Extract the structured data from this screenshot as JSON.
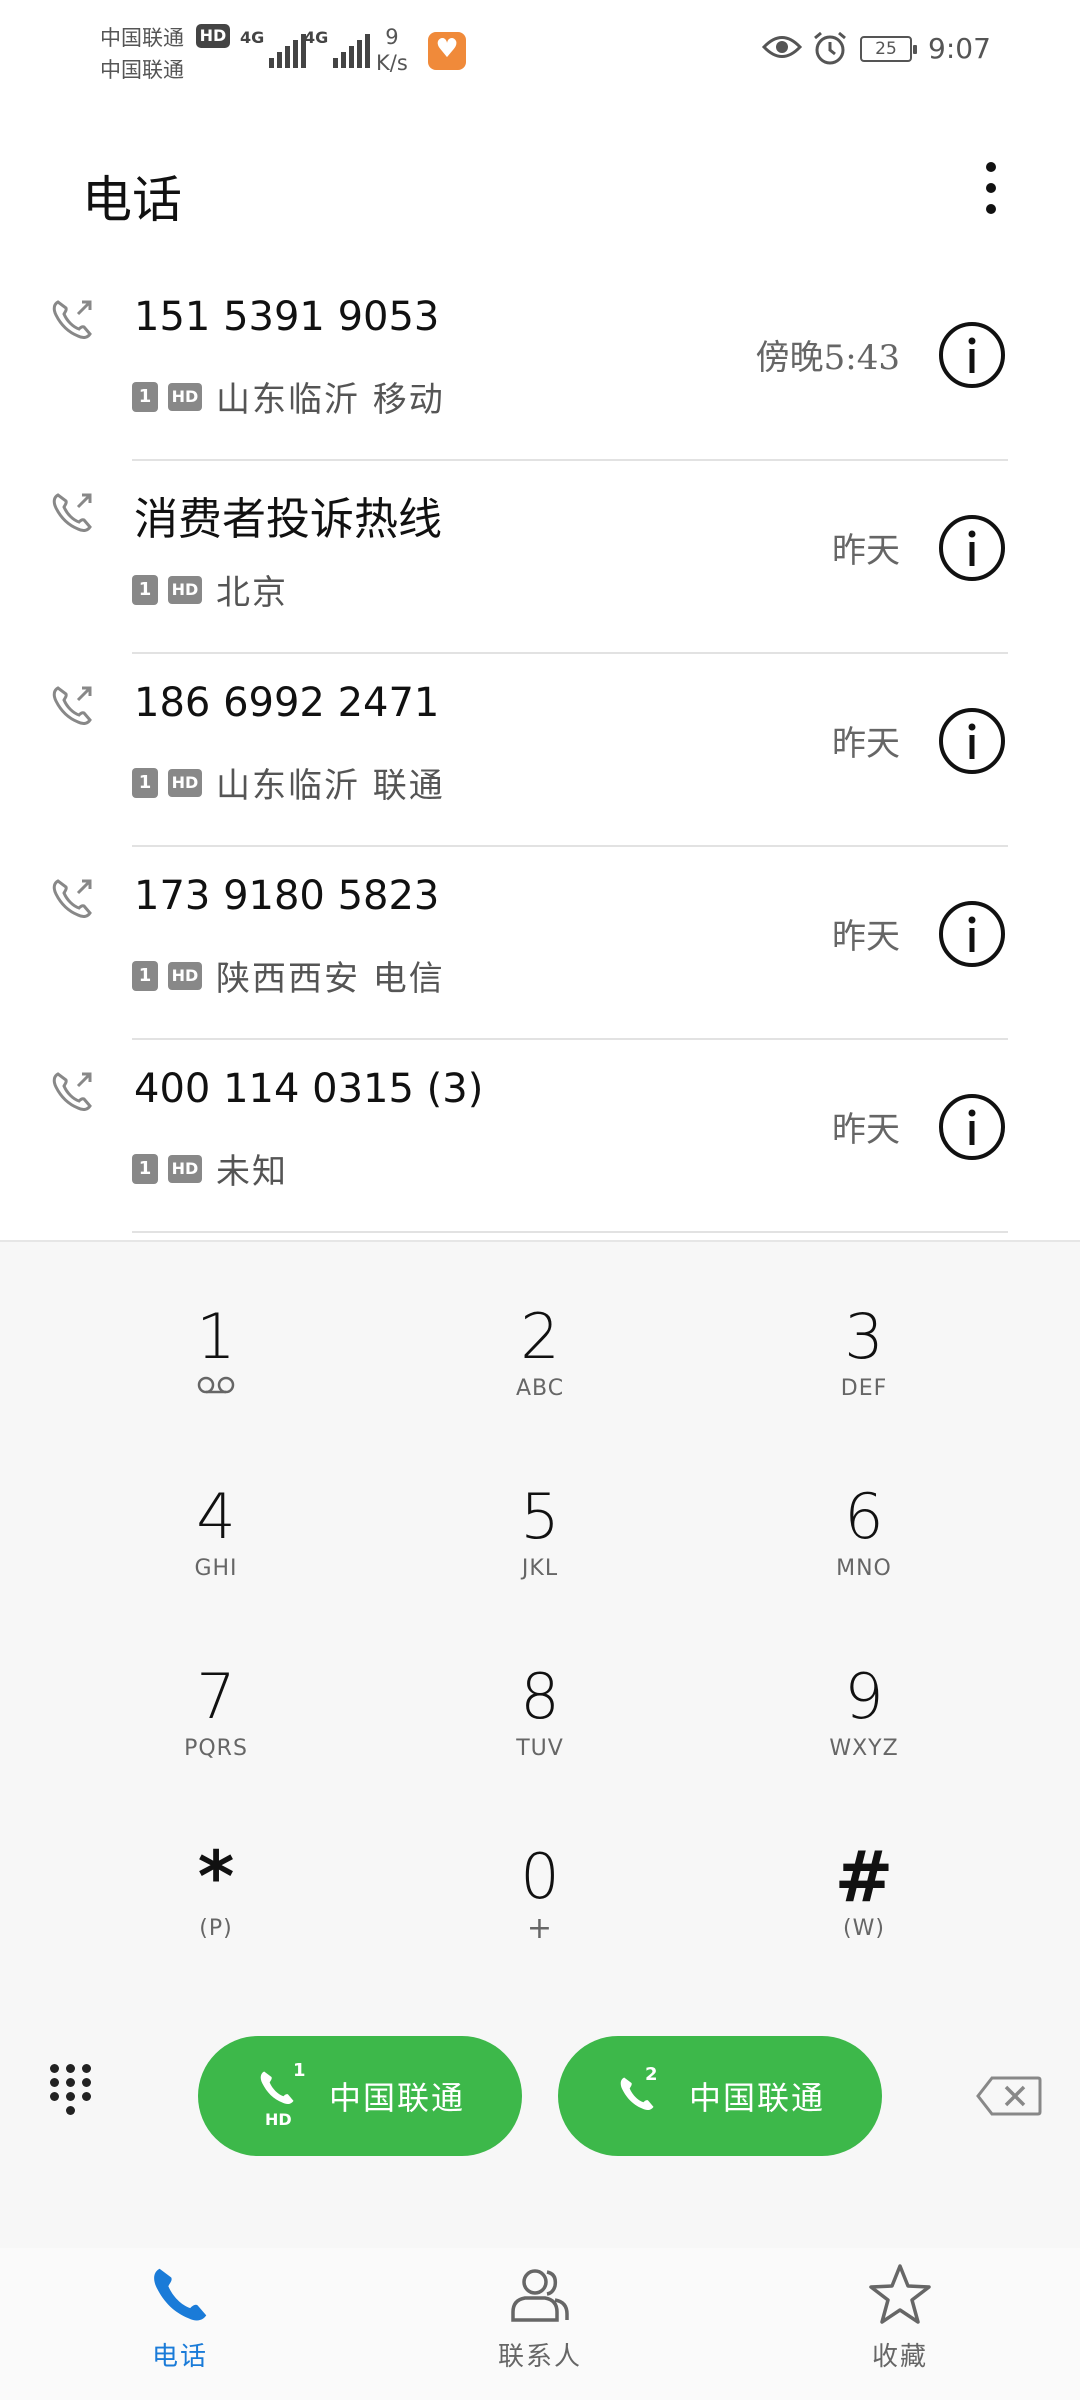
{
  "status_bar": {
    "carrier_top": "中国联通",
    "carrier_bottom": "中国联通",
    "hd": "HD",
    "net1": "4G",
    "net2": "4G",
    "speed_value": "9",
    "speed_unit": "K/s",
    "battery": "25",
    "time": "9:07"
  },
  "header": {
    "title": "电话"
  },
  "calls": [
    {
      "name": "151  5391  9053",
      "sim": "1",
      "hd": "HD",
      "location": "山东临沂  移动",
      "time": "傍晚5:43"
    },
    {
      "name": "消费者投诉热线",
      "sim": "1",
      "hd": "HD",
      "location": "北京",
      "time": "昨天"
    },
    {
      "name": "186  6992  2471",
      "sim": "1",
      "hd": "HD",
      "location": "山东临沂  联通",
      "time": "昨天"
    },
    {
      "name": "173  9180  5823",
      "sim": "1",
      "hd": "HD",
      "location": "陕西西安  电信",
      "time": "昨天"
    },
    {
      "name": "400  114  0315 (3)",
      "sim": "1",
      "hd": "HD",
      "location": "未知",
      "time": "昨天"
    }
  ],
  "dialpad": {
    "keys": [
      {
        "digit": "1",
        "letters": ""
      },
      {
        "digit": "2",
        "letters": "ABC"
      },
      {
        "digit": "3",
        "letters": "DEF"
      },
      {
        "digit": "4",
        "letters": "GHI"
      },
      {
        "digit": "5",
        "letters": "JKL"
      },
      {
        "digit": "6",
        "letters": "MNO"
      },
      {
        "digit": "7",
        "letters": "PQRS"
      },
      {
        "digit": "8",
        "letters": "TUV"
      },
      {
        "digit": "9",
        "letters": "WXYZ"
      },
      {
        "digit": "*",
        "letters": "(P)"
      },
      {
        "digit": "0",
        "letters": "+"
      },
      {
        "digit": "#",
        "letters": "(W)"
      }
    ],
    "call_sim1": {
      "carrier": "中国联通",
      "sim": "1",
      "hd": "HD"
    },
    "call_sim2": {
      "carrier": "中国联通",
      "sim": "2"
    }
  },
  "bottom_nav": {
    "phone": "电话",
    "contacts": "联系人",
    "favorites": "收藏"
  },
  "colors": {
    "accent": "#1a7bd8",
    "call_green": "#3db84a"
  }
}
